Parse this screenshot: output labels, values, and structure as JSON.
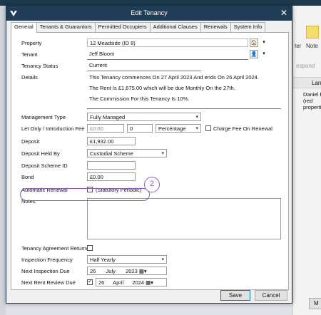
{
  "background": {
    "toolbar_labels": [
      "ter",
      "Note"
    ],
    "respond_label": "espond",
    "column_header": "Land",
    "cell_lines": [
      "Daniel E",
      "(red",
      "propertie"
    ],
    "bottom_button": "M"
  },
  "dialog": {
    "title": "Edit Tenancy",
    "tabs": [
      "General",
      "Tenants & Guarantors",
      "Permitted Occupiers",
      "Additional Clauses",
      "Renewals",
      "System Info"
    ]
  },
  "form": {
    "property_label": "Property",
    "property_value": "12 Meadside (ID 8)",
    "tenant_label": "Tenant",
    "tenant_value": "Jeff Bloom",
    "status_label": "Tenancy Status",
    "status_value": "Current",
    "details_label": "Details",
    "details_lines": [
      "This Tenancy commences On 27 April 2023 And ends On 26 April 2024.",
      "The Rent Is £1,675.00 which will be due Monthly On the 27th.",
      "The Commission For this Tenancy Is 10%."
    ],
    "management_label": "Management Type",
    "management_value": "Fully Managed",
    "letonly_label": "Let Only / Introduction  Fee",
    "letonly_amount": "£0.00",
    "letonly_number": "0",
    "letonly_type": "Percentage",
    "charge_fee_label": "Charge Fee On Renewal",
    "deposit_label": "Deposit",
    "deposit_value": "£1,932.00",
    "deposit_held_label": "Deposit Held By",
    "deposit_held_value": "Custodial Scheme",
    "deposit_scheme_label": "Deposit Scheme ID",
    "deposit_scheme_value": "",
    "callout_number": "2",
    "bond_label": "Bond",
    "bond_value": "£0.00",
    "auto_renewal_label": "Automatic Renewal",
    "statutory_label": "(Statutory Periodic)",
    "notes_label": "Notes",
    "notes_value": "",
    "agreement_label": "Tenancy Agreement Returned",
    "inspection_freq_label": "Inspection Frequency",
    "inspection_freq_value": "Half Yearly",
    "next_inspection_label": "Next Inspection Due",
    "next_inspection": {
      "day": "26",
      "month": "July",
      "year": "2023"
    },
    "next_rent_label": "Next Rent Review Due",
    "next_rent": {
      "day": "26",
      "month": "April",
      "year": "2024"
    }
  },
  "buttons": {
    "save": "Save",
    "cancel": "Cancel"
  }
}
